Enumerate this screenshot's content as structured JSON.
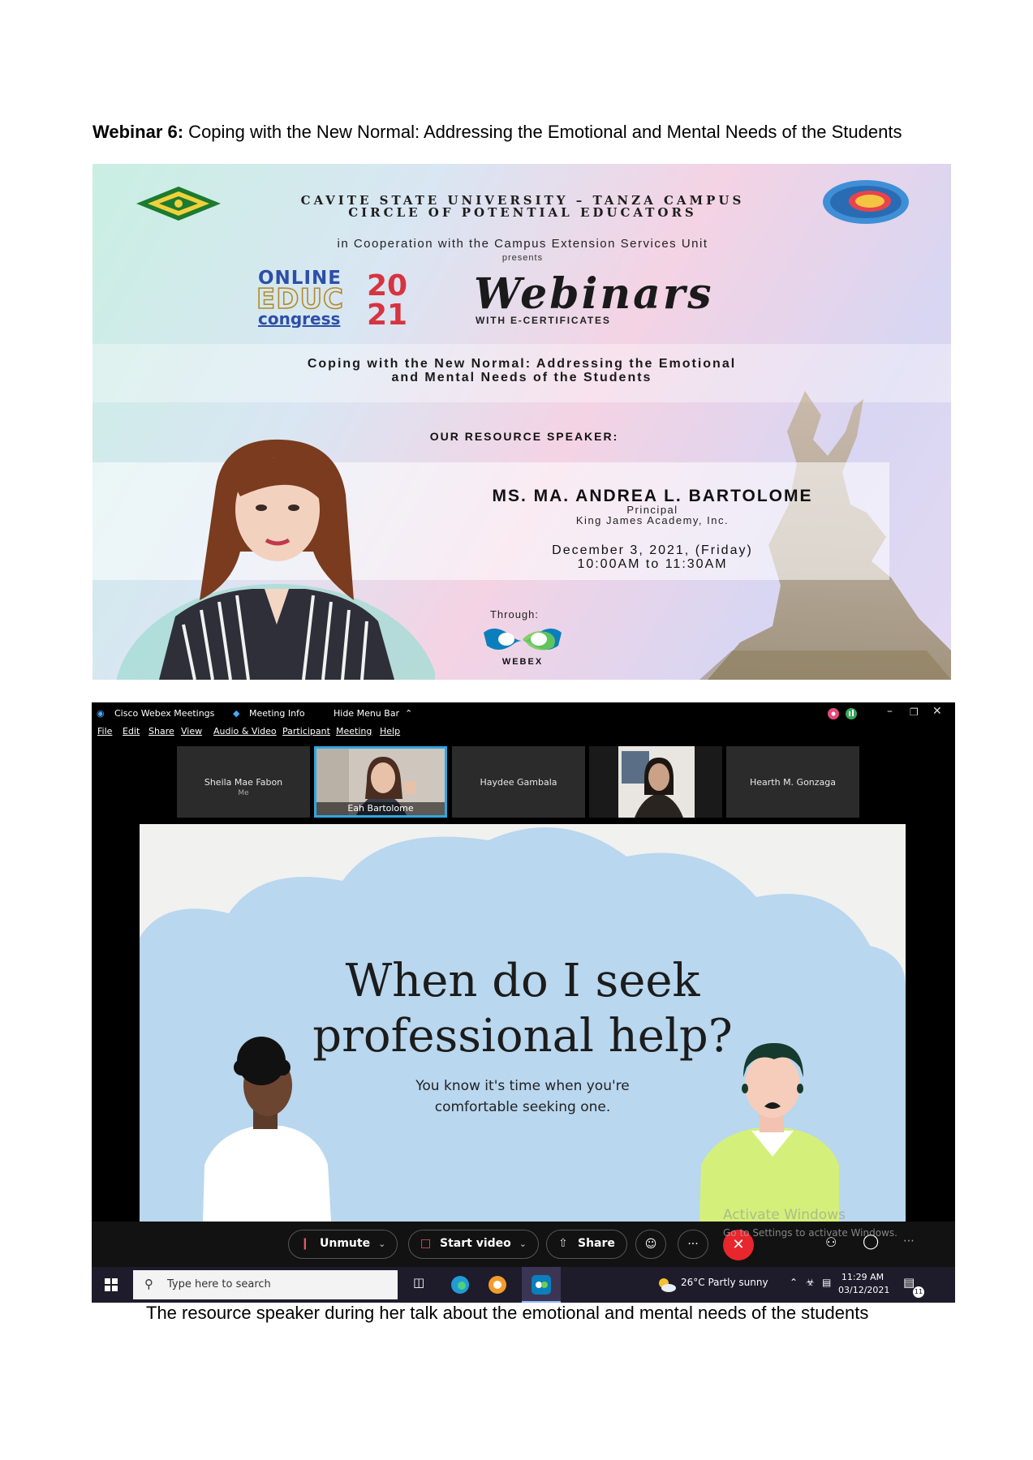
{
  "document": {
    "title_bold": "Webinar 6:",
    "title_rest": " Coping with the New Normal: Addressing the Emotional and Mental Needs of the Students",
    "caption": "The resource speaker during her talk about the emotional and mental needs of the students"
  },
  "poster": {
    "university_line1": "CAVITE STATE UNIVERSITY – TANZA CAMPUS",
    "university_line2": "CIRCLE OF POTENTIAL EDUCATORS",
    "cooperation": "in Cooperation with the Campus Extension Services Unit",
    "presents": "presents",
    "webinars": "Webinars",
    "with_certificates": "WITH E-CERTIFICATES",
    "topic_line1": "Coping with the New Normal: Addressing the Emotional",
    "topic_line2": "and Mental Needs of the Students",
    "resource_speaker_label": "OUR RESOURCE SPEAKER:",
    "speaker_name": "MS. MA. ANDREA L. BARTOLOME",
    "speaker_position": "Principal",
    "speaker_school": "King James Academy, Inc.",
    "date": "December 3, 2021, (Friday)",
    "time": "10:00AM to 11:30AM",
    "through": "Through:",
    "platform": "WEBEX"
  },
  "webex": {
    "app_title": "Cisco Webex Meetings",
    "meeting_info": "Meeting Info",
    "hide_menu_bar": "Hide Menu Bar",
    "menu": [
      "File",
      "Edit",
      "Share",
      "View",
      "Audio & Video",
      "Participant",
      "Meeting",
      "Help"
    ],
    "participants": [
      {
        "name": "Sheila Mae Fabon",
        "sub": "Me"
      },
      {
        "name": "Eah Bartolome"
      },
      {
        "name": "Haydee Gambala"
      },
      {
        "name": ""
      },
      {
        "name": "Hearth M. Gonzaga"
      }
    ],
    "slide_title_line1": "When do I seek",
    "slide_title_line2": "professional help?",
    "slide_sub_line1": "You know it's time when you're",
    "slide_sub_line2": "comfortable seeking one.",
    "controls": {
      "unmute": "Unmute",
      "start_video": "Start video",
      "share": "Share",
      "more": "···"
    },
    "activate_line1": "Activate Windows",
    "activate_line2": "Go to Settings to activate Windows.",
    "accent_red": "#e8262d"
  },
  "taskbar": {
    "search_placeholder": "Type here to search",
    "weather": "26°C  Partly sunny",
    "time": "11:29 AM",
    "date": "03/12/2021",
    "notifications": "11"
  }
}
